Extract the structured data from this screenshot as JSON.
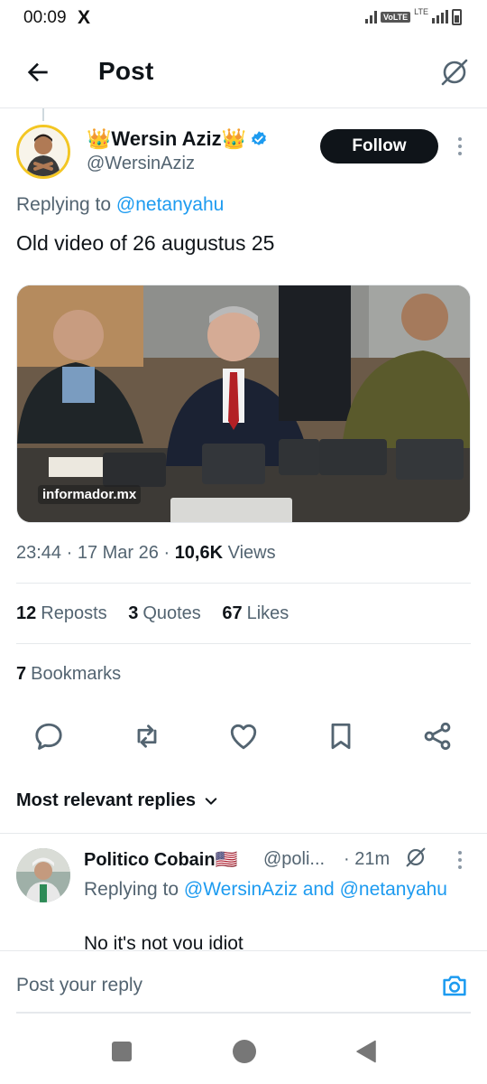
{
  "status_bar": {
    "time": "00:09",
    "app_glyph": "X",
    "volte": "VoLTE",
    "lte": "LTE"
  },
  "header": {
    "title": "Post",
    "back_icon": "arrow-left-icon",
    "grok_icon": "grok-icon"
  },
  "post": {
    "author_name": "👑Wersin Aziz👑",
    "author_handle": "@WersinAziz",
    "follow_label": "Follow",
    "replying_prefix": "Replying to",
    "replying_handle": "@netanyahu",
    "text": "Old video of 26 augustus 25",
    "media_caption": "informador.mx",
    "time": "23:44",
    "dot1": " · ",
    "date": "17 Mar 26",
    "dot2": " · ",
    "views_count": "10,6K",
    "views_label": " Views",
    "reposts_count": "12",
    "reposts_label": "Reposts",
    "quotes_count": "3",
    "quotes_label": "Quotes",
    "likes_count": "67",
    "likes_label": "Likes",
    "bookmarks_count": "7",
    "bookmarks_label": "Bookmarks"
  },
  "actions": [
    "reply-icon",
    "repost-icon",
    "like-icon",
    "bookmark-icon",
    "share-icon"
  ],
  "replies": {
    "sort_label": "Most relevant replies"
  },
  "reply": {
    "name": "Politico Cobain🇺🇸",
    "handle": "@poli...",
    "time": "· 21m",
    "replying_prefix": "Replying to",
    "replying_handle_1": "@WersinAziz",
    "replying_and": " and",
    "replying_handle_2": "@netanyahu",
    "text": "No it's not you idiot"
  },
  "compose": {
    "placeholder": "Post your reply"
  },
  "colors": {
    "accent": "#1d9bf0",
    "text": "#0f1419",
    "secondary": "#536471",
    "border": "#e6e9ec",
    "avatar_ring": "#f3c623"
  }
}
